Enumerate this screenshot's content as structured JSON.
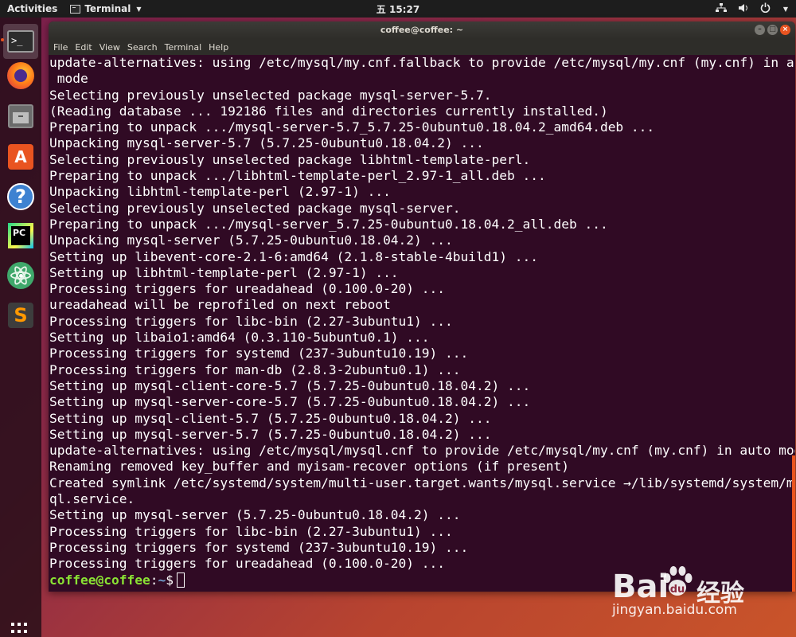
{
  "topbar": {
    "activities": "Activities",
    "app_menu": "Terminal",
    "clock": "五 15:27"
  },
  "dock": {
    "apps": [
      {
        "name": "terminal",
        "glyph": ">_"
      },
      {
        "name": "firefox"
      },
      {
        "name": "files"
      },
      {
        "name": "software",
        "glyph": "A"
      },
      {
        "name": "help",
        "glyph": "?"
      },
      {
        "name": "pycharm",
        "glyph": "PC"
      },
      {
        "name": "atom"
      },
      {
        "name": "sublime",
        "glyph": "S"
      }
    ]
  },
  "window": {
    "title": "coffee@coffee: ~",
    "menu": [
      "File",
      "Edit",
      "View",
      "Search",
      "Terminal",
      "Help"
    ]
  },
  "terminal": {
    "lines": [
      "update-alternatives: using /etc/mysql/my.cnf.fallback to provide /etc/mysql/my.cnf (my.cnf) in auto",
      " mode",
      "Selecting previously unselected package mysql-server-5.7.",
      "(Reading database ... 192186 files and directories currently installed.)",
      "Preparing to unpack .../mysql-server-5.7_5.7.25-0ubuntu0.18.04.2_amd64.deb ...",
      "Unpacking mysql-server-5.7 (5.7.25-0ubuntu0.18.04.2) ...",
      "Selecting previously unselected package libhtml-template-perl.",
      "Preparing to unpack .../libhtml-template-perl_2.97-1_all.deb ...",
      "Unpacking libhtml-template-perl (2.97-1) ...",
      "Selecting previously unselected package mysql-server.",
      "Preparing to unpack .../mysql-server_5.7.25-0ubuntu0.18.04.2_all.deb ...",
      "Unpacking mysql-server (5.7.25-0ubuntu0.18.04.2) ...",
      "Setting up libevent-core-2.1-6:amd64 (2.1.8-stable-4build1) ...",
      "Setting up libhtml-template-perl (2.97-1) ...",
      "Processing triggers for ureadahead (0.100.0-20) ...",
      "ureadahead will be reprofiled on next reboot",
      "Processing triggers for libc-bin (2.27-3ubuntu1) ...",
      "Setting up libaio1:amd64 (0.3.110-5ubuntu0.1) ...",
      "Processing triggers for systemd (237-3ubuntu10.19) ...",
      "Processing triggers for man-db (2.8.3-2ubuntu0.1) ...",
      "Setting up mysql-client-core-5.7 (5.7.25-0ubuntu0.18.04.2) ...",
      "Setting up mysql-server-core-5.7 (5.7.25-0ubuntu0.18.04.2) ...",
      "Setting up mysql-client-5.7 (5.7.25-0ubuntu0.18.04.2) ...",
      "Setting up mysql-server-5.7 (5.7.25-0ubuntu0.18.04.2) ...",
      "update-alternatives: using /etc/mysql/mysql.cnf to provide /etc/mysql/my.cnf (my.cnf) in auto mode",
      "Renaming removed key_buffer and myisam-recover options (if present)",
      "Created symlink /etc/systemd/system/multi-user.target.wants/mysql.service →/lib/systemd/system/mys",
      "ql.service.",
      "Setting up mysql-server (5.7.25-0ubuntu0.18.04.2) ...",
      "Processing triggers for libc-bin (2.27-3ubuntu1) ...",
      "Processing triggers for systemd (237-3ubuntu10.19) ...",
      "Processing triggers for ureadahead (0.100.0-20) ..."
    ],
    "prompt": {
      "user_host": "coffee@coffee",
      "separator": ":",
      "path": "~",
      "symbol": "$"
    }
  },
  "watermark": {
    "brand": "Bai",
    "product": "经验",
    "url": "jingyan.baidu.com"
  }
}
